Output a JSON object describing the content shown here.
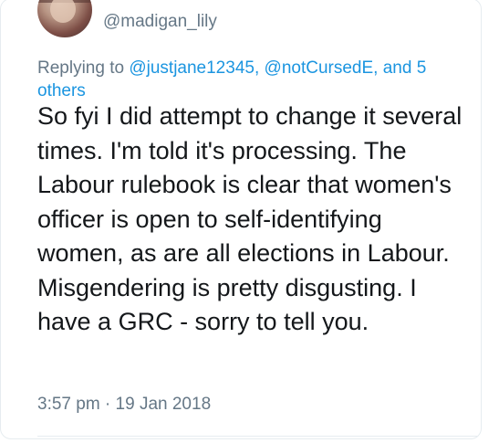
{
  "tweet": {
    "handle": "@madigan_lily",
    "reply": {
      "prefix": "Replying to ",
      "mention_1": "@justjane12345",
      "separator": ", ",
      "mention_2": "@notCursedE",
      "suffix": ", and 5 others"
    },
    "text": "So fyi I did attempt to change it several times. I'm told it's processing. The Labour rulebook is clear that women's officer is open to self-identifying women, as are all elections in Labour. Misgendering is pretty disgusting. I have a GRC - sorry to tell you.",
    "timestamp": "3:57 pm · 19 Jan 2018"
  },
  "colors": {
    "text": "#14171a",
    "secondary": "#657786",
    "link": "#1b95e0",
    "border": "#e6ecf0"
  }
}
